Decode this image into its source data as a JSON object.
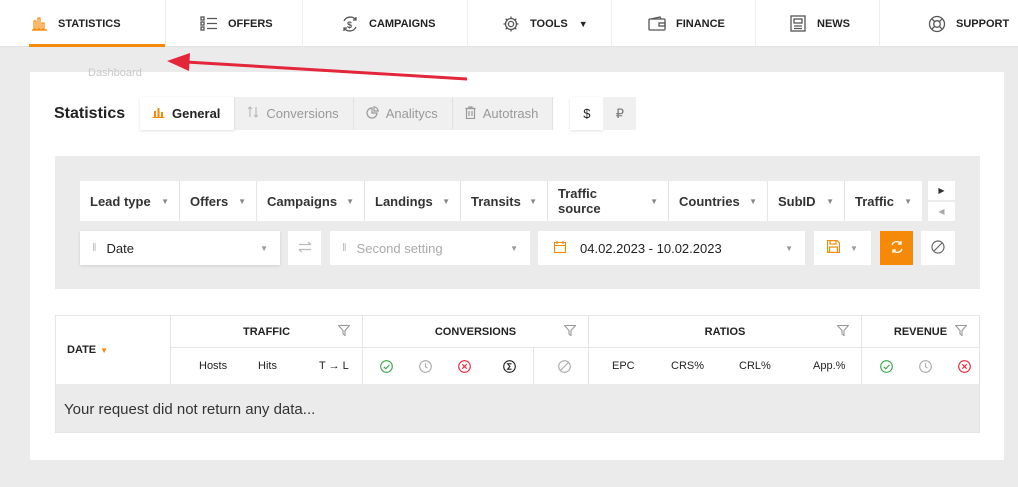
{
  "nav": {
    "items": [
      {
        "label": "STATISTICS",
        "icon": "bar-chart-icon",
        "active": true
      },
      {
        "label": "OFFERS",
        "icon": "list-icon"
      },
      {
        "label": "CAMPAIGNS",
        "icon": "dollar-cycle-icon"
      },
      {
        "label": "TOOLS",
        "icon": "gear-icon",
        "has_dropdown": true
      },
      {
        "label": "FINANCE",
        "icon": "wallet-icon"
      },
      {
        "label": "NEWS",
        "icon": "newspaper-icon"
      },
      {
        "label": "SUPPORT",
        "icon": "lifebuoy-icon"
      }
    ]
  },
  "hint_text": "Dashboard",
  "page": {
    "title": "Statistics",
    "tabs": [
      {
        "label": "General",
        "icon": "bar-chart-icon",
        "active": true
      },
      {
        "label": "Conversions",
        "icon": "sort-arrows-icon"
      },
      {
        "label": "Analitycs",
        "icon": "pie-chart-icon"
      },
      {
        "label": "Autotrash",
        "icon": "trash-icon"
      }
    ],
    "currencies": [
      {
        "label": "$",
        "active": true
      },
      {
        "label": "₽"
      }
    ]
  },
  "filters": {
    "items": [
      "Lead type",
      "Offers",
      "Campaigns",
      "Landings",
      "Transits",
      "Traffic source",
      "Countries",
      "SubID",
      "Traffic"
    ]
  },
  "grouping": {
    "first": "Date",
    "second_placeholder": "Second setting",
    "date_range": "04.02.2023 - 10.02.2023"
  },
  "table": {
    "date_header": "DATE",
    "groups": {
      "traffic": {
        "label": "TRAFFIC",
        "cols": [
          "Hosts",
          "Hits",
          "T → L"
        ]
      },
      "conversions": {
        "label": "CONVERSIONS"
      },
      "ratios": {
        "label": "RATIOS",
        "cols": [
          "EPC",
          "CRS%",
          "CRL%",
          "App.%"
        ]
      },
      "revenue": {
        "label": "REVENUE"
      }
    },
    "empty_message": "Your request did not return any data..."
  },
  "colors": {
    "accent": "#f5890a",
    "annotation": "#e3263a",
    "approved": "#3aa64c",
    "rejected": "#e3263a"
  }
}
